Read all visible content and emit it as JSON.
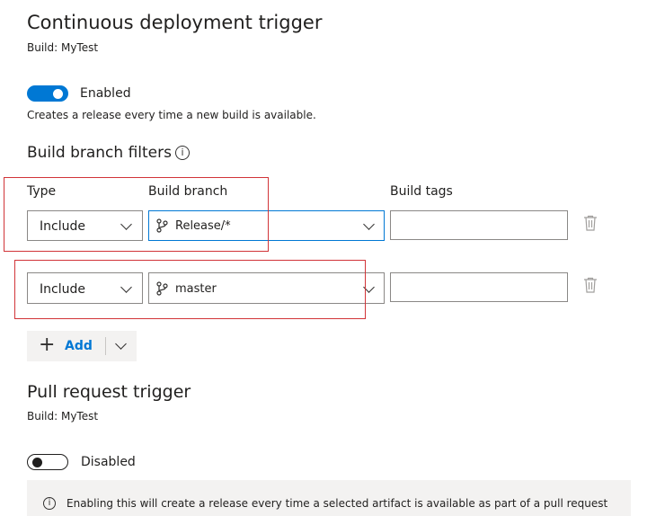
{
  "cd_trigger": {
    "title": "Continuous deployment trigger",
    "build_label": "Build: MyTest",
    "toggle_label": "Enabled",
    "toggle_state": "on",
    "description": "Creates a release every time a new build is available."
  },
  "filters": {
    "title": "Build branch filters",
    "info_icon": "i",
    "col_type": "Type",
    "col_branch": "Build branch",
    "col_tags": "Build tags",
    "rows": [
      {
        "type": "Include",
        "branch": "Release/*",
        "tags": ""
      },
      {
        "type": "Include",
        "branch": "master",
        "tags": ""
      }
    ]
  },
  "add_button": {
    "label": "Add"
  },
  "pr_trigger": {
    "title": "Pull request trigger",
    "build_label": "Build: MyTest",
    "toggle_label": "Disabled",
    "toggle_state": "off",
    "info_text": "Enabling this will create a release every time a selected artifact is available as part of a pull request"
  },
  "colors": {
    "accent": "#0078d4",
    "annotation_red": "#d13438"
  },
  "icons": {
    "branch": "branch-icon",
    "trash": "trash-icon",
    "chevron": "chevron-down-icon",
    "info": "info-icon",
    "plus": "plus-icon"
  }
}
